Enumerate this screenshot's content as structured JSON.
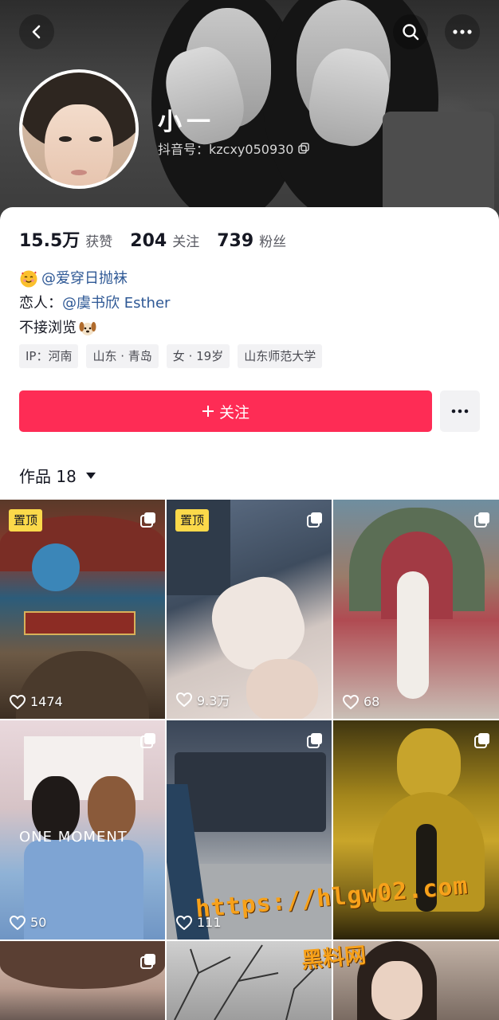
{
  "profile": {
    "nickname": "小一",
    "douyin_id": "抖音号：kzcxy050930"
  },
  "stats": [
    {
      "value": "15.5万",
      "label": "获赞"
    },
    {
      "value": "204",
      "label": "关注"
    },
    {
      "value": "739",
      "label": "粉丝"
    }
  ],
  "bio": {
    "line1_mention": "@爱穿日抛袜",
    "line2_prefix": "恋人：",
    "line2_mention": "@虞书欣 Esther",
    "line3": "不接浏览"
  },
  "tags": [
    "IP：河南",
    "山东 · 青岛",
    "女 · 19岁",
    "山东师范大学"
  ],
  "actions": {
    "follow_label": "关注"
  },
  "works": {
    "tab_label": "作品 18"
  },
  "grid": [
    {
      "pinned": "置顶",
      "likes": "1474"
    },
    {
      "pinned": "置顶",
      "likes": "9.3万"
    },
    {
      "likes": "68"
    },
    {
      "likes": "50"
    },
    {
      "likes": "111"
    },
    {
      "likes": ""
    },
    {
      "likes": ""
    },
    {
      "likes": ""
    },
    {
      "likes": ""
    }
  ],
  "overlay_text": {
    "url": "https://hlgw02.com",
    "site_name": "黑料网",
    "image_caption": "ONE MOMENT"
  },
  "colors": {
    "follow": "#fe2c55",
    "mention": "#2e5895",
    "pin_badge": "#fbd94a"
  },
  "icons": [
    "back-icon",
    "search-icon",
    "more-icon",
    "copy-icon",
    "plus-icon",
    "heart-icon",
    "multi-image-icon",
    "caret-down-icon"
  ]
}
